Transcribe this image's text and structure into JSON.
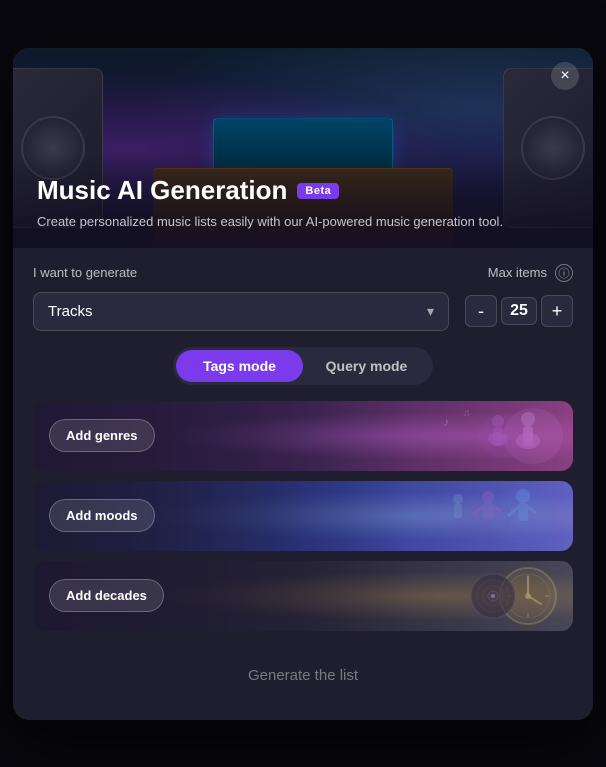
{
  "modal": {
    "title": "Music AI Generation",
    "beta_badge": "Beta",
    "subtitle": "Create personalized music lists easily with our AI-powered music generation tool.",
    "close_label": "×"
  },
  "controls": {
    "generate_label": "I want to generate",
    "max_items_label": "Max items",
    "track_select_value": "Tracks",
    "counter_value": "25",
    "decrement_label": "-",
    "increment_label": "+"
  },
  "mode_toggle": {
    "tags_mode_label": "Tags mode",
    "query_mode_label": "Query mode"
  },
  "tag_rows": [
    {
      "label": "Add genres"
    },
    {
      "label": "Add moods"
    },
    {
      "label": "Add decades"
    }
  ],
  "footer": {
    "generate_label": "Generate the list"
  }
}
